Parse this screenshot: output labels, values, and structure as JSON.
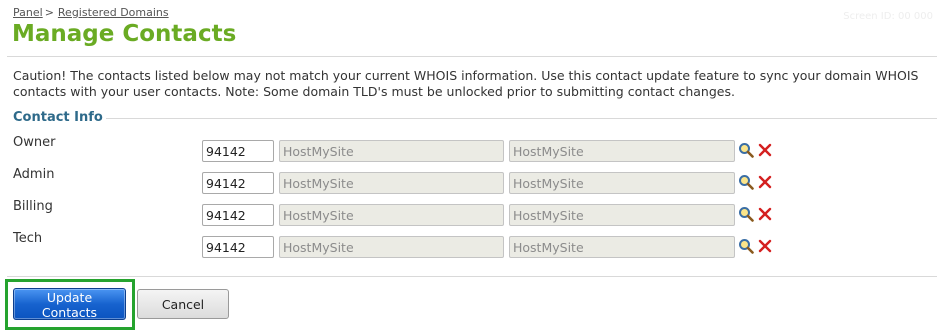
{
  "breadcrumb": {
    "panel": "Panel",
    "separator": ">",
    "current": "Registered Domains"
  },
  "ghost_text": "Screen ID: 00 000",
  "page_title": "Manage Contacts",
  "caution_text": "Caution! The contacts listed below may not match your current WHOIS information. Use this contact update feature to sync your domain WHOIS contacts with your user contacts. Note: Some domain TLD's must be unlocked prior to submitting contact changes.",
  "section": {
    "legend": "Contact Info"
  },
  "contacts": [
    {
      "label": "Owner",
      "contact_id": "94142",
      "field_a": "HostMySite",
      "field_b": "HostMySite"
    },
    {
      "label": "Admin",
      "contact_id": "94142",
      "field_a": "HostMySite",
      "field_b": "HostMySite"
    },
    {
      "label": "Billing",
      "contact_id": "94142",
      "field_a": "HostMySite",
      "field_b": "HostMySite"
    },
    {
      "label": "Tech",
      "contact_id": "94142",
      "field_a": "HostMySite",
      "field_b": "HostMySite"
    }
  ],
  "icons": {
    "lookup": "magnifier-icon",
    "delete": "red-x-icon"
  },
  "buttons": {
    "update": "Update Contacts",
    "cancel": "Cancel"
  },
  "colors": {
    "title_green": "#6aab23",
    "legend_blue": "#2e6a8a",
    "primary_blue": "#1763cf",
    "highlight_green": "#25a32e",
    "delete_red": "#d42020"
  }
}
